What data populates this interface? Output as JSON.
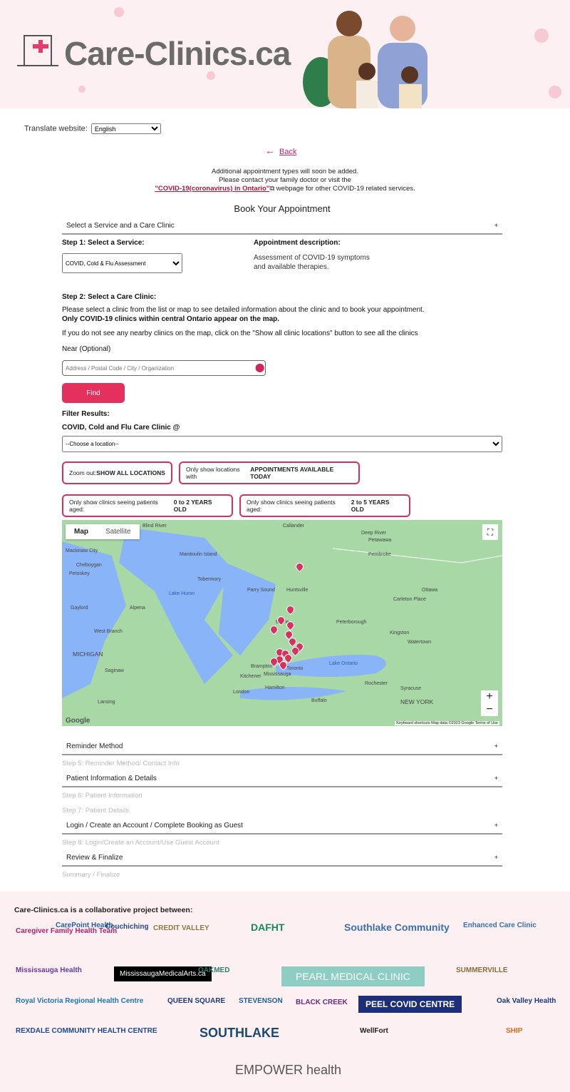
{
  "header": {
    "site_name": "Care-Clinics.ca"
  },
  "translate": {
    "label": "Translate website:",
    "value": "English"
  },
  "back": {
    "label": "Back"
  },
  "notice": {
    "line1": "Additional appointment types will soon be added.",
    "line2": "Please contact your family doctor or visit the",
    "link": "\"COVID-19(coronavirus) in Ontario\"",
    "line3": " webpage for other COVID-19 related services."
  },
  "page_title": "Book Your Appointment",
  "section1": {
    "title": "Select a Service and a Care Clinic",
    "toggle": "+"
  },
  "step1": {
    "label": "Step 1: Select a Service:",
    "value": "COVID, Cold & Flu Assessment",
    "desc_label": "Appointment description:",
    "desc": "Assessment of COVID-19 symptoms",
    "desc2": "and available therapies."
  },
  "step2": {
    "label": "Step 2: Select a Care Clinic:",
    "p1": "Please select a clinic from the list or map to see detailed information about the clinic and to book your appointment.",
    "p1b": "Only COVID-19 clinics within central Ontario appear on the map.",
    "p2": "If you do not see any nearby clinics on the map, click on the \"Show all clinic locations\" button to see all the clinics",
    "near": "Near (Optional)",
    "placeholder": "Address / Postal Code / City / Organization",
    "find": "Find",
    "filter": "Filter Results:",
    "clinic_label": "COVID, Cold and Flu Care Clinic @",
    "location": "--Choose a location--"
  },
  "filters": [
    {
      "pre": "Zoom out: ",
      "bold": "SHOW ALL LOCATIONS"
    },
    {
      "pre": "Only show locations with ",
      "bold": "APPOINTMENTS AVAILABLE TODAY"
    },
    {
      "pre": "Only show clinics seeing patients aged: ",
      "bold": "0 to 2 YEARS OLD"
    },
    {
      "pre": "Only show clinics seeing patients aged: ",
      "bold": "2 to 5 YEARS OLD"
    }
  ],
  "map": {
    "tab_map": "Map",
    "tab_sat": "Satellite",
    "zoom_in": "+",
    "zoom_out": "−",
    "attribution": "Keyboard shortcuts   Map data ©2023 Google   Terms of Use",
    "google": "Google",
    "labels": [
      "Blind River",
      "Callander",
      "Deep River",
      "Mackinaw City",
      "Manitoulin Island",
      "Petawawa",
      "Cheboygan",
      "Pembroke",
      "Petoskey",
      "Tobermory",
      "Parry Sound",
      "Huntsville",
      "Ottawa",
      "Gaylord",
      "Alpena",
      "Carleton Place",
      "Lake Huron",
      "Peterborough",
      "Kingston",
      "West Branch",
      "Barrie",
      "MICHIGAN",
      "Watertown",
      "Brampton",
      "Toronto",
      "Mississauga",
      "Lake Ontario",
      "Saginaw",
      "Kitchener",
      "Hamilton",
      "Rochester",
      "Syracuse",
      "London",
      "Buffalo",
      "Lansing",
      "NEW YORK"
    ]
  },
  "accordion": [
    {
      "title": "Reminder Method",
      "toggle": "+",
      "subs": [
        "Step 5: Reminder Method/ Contact Info"
      ]
    },
    {
      "title": "Patient Information & Details",
      "toggle": "+",
      "subs": [
        "Step 6: Patient Information",
        "Step 7: Patient Details"
      ]
    },
    {
      "title": "Login / Create an Account / Complete Booking as Guest",
      "toggle": "+",
      "subs": [
        "Step 8: Login/Create an Account/Use Guest Account"
      ]
    },
    {
      "title": "Review & Finalize",
      "toggle": "+",
      "subs": [
        "Summary / Finalize"
      ]
    }
  ],
  "footer": {
    "title": "Care-Clinics.ca is a collaborative project between:",
    "partners": [
      "Caregiver Family Health Team",
      "CarePoint Health",
      "Couchiching",
      "CREDIT VALLEY",
      "DAFHT",
      "Southlake Community",
      "Enhanced Care Clinic",
      "Mississauga Health",
      "MississaugaMedicalArts.ca",
      "OAKMED",
      "PEARL MEDICAL CLINIC",
      "SUMMERVILLE",
      "Royal Victoria Regional Health Centre",
      "QUEEN SQUARE",
      "STEVENSON",
      "BLACK CREEK",
      "PEEL COVID CENTRE",
      "Oak Valley Health",
      "REXDALE COMMUNITY HEALTH CENTRE",
      "SOUTHLAKE",
      "WellFort",
      "SHIP",
      "EMPOWER health"
    ]
  },
  "colors": {
    "accent": "#d8305f",
    "header_bg": "#fdf0f3",
    "map_land": "#a8d8a6",
    "map_water": "#8ab4f8"
  }
}
